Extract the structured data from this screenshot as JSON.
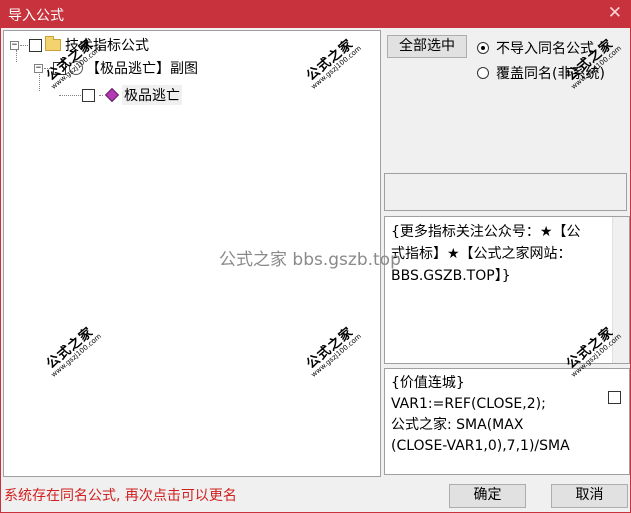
{
  "window": {
    "title": "导入公式",
    "close_glyph": "✕"
  },
  "tree": {
    "root": {
      "label": "技术指标公式",
      "expander": "⊟"
    },
    "child": {
      "label": "【极品逃亡】副图",
      "expander": "⊟"
    },
    "leaf": {
      "label": "极品逃亡",
      "expander": "⊞"
    }
  },
  "buttons": {
    "select_all": "全部选中",
    "ok": "确定",
    "cancel": "取消"
  },
  "radios": [
    {
      "label": "不导入同名公式",
      "checked": true
    },
    {
      "label": "覆盖同名(非系统)",
      "checked": false
    }
  ],
  "info": {
    "line1": "{更多指标关注公众号：★【公",
    "line2": "式指标】★【公式之家网站：",
    "line3": "BBS.GSZB.TOP】}"
  },
  "code": {
    "line1": "{价值连城}",
    "line2": "VAR1:=REF(CLOSE,2);",
    "line3": "公式之家: SMA(MAX",
    "line4": "(CLOSE-VAR1,0),7,1)/SMA"
  },
  "status": "系统存在同名公式, 再次点击可以更名",
  "watermarks": {
    "center": "公式之家 bbs.gszb.top",
    "stamp_big": "公式之家",
    "stamp_small": "www.gszj100.com"
  },
  "colors": {
    "title_bar": "#c8323c",
    "status_text": "#d02020"
  }
}
